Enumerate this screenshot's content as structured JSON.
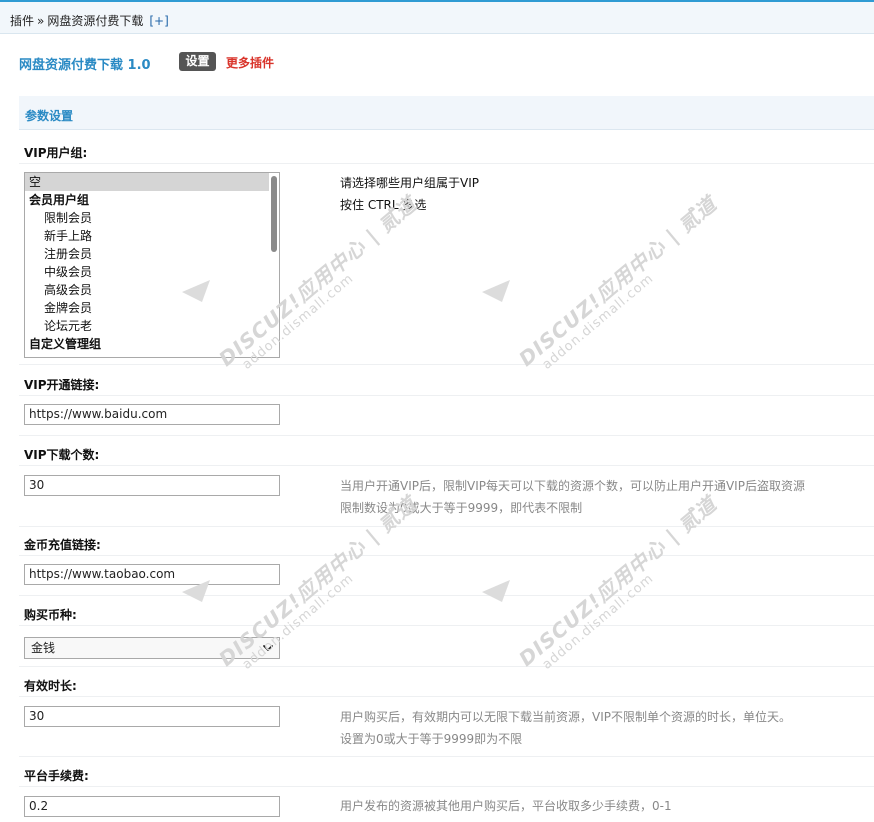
{
  "breadcrumb": {
    "root": "插件",
    "separator": "»",
    "current": "网盘资源付费下载",
    "add_label": "[+]"
  },
  "plugin": {
    "title": "网盘资源付费下载 1.0",
    "settings_label": "设置",
    "more_label": "更多插件"
  },
  "section": {
    "title": "参数设置"
  },
  "fields": {
    "vip_group": {
      "label": "VIP用户组:",
      "options": [
        {
          "text": "空",
          "kind": "item",
          "selected": true
        },
        {
          "text": "会员用户组",
          "kind": "group",
          "selected": false
        },
        {
          "text": "限制会员",
          "kind": "sub",
          "selected": false
        },
        {
          "text": "新手上路",
          "kind": "sub",
          "selected": false
        },
        {
          "text": "注册会员",
          "kind": "sub",
          "selected": false
        },
        {
          "text": "中级会员",
          "kind": "sub",
          "selected": false
        },
        {
          "text": "高级会员",
          "kind": "sub",
          "selected": false
        },
        {
          "text": "金牌会员",
          "kind": "sub",
          "selected": false
        },
        {
          "text": "论坛元老",
          "kind": "sub",
          "selected": false
        },
        {
          "text": "自定义管理组",
          "kind": "group",
          "selected": false
        }
      ],
      "hint_1": "请选择哪些用户组属于VIP",
      "hint_2": "按住 CTRL 多选"
    },
    "vip_link": {
      "label": "VIP开通链接:",
      "value": "https://www.baidu.com"
    },
    "vip_downloads": {
      "label": "VIP下载个数:",
      "value": "30",
      "hint_1": "当用户开通VIP后，限制VIP每天可以下载的资源个数，可以防止用户开通VIP后盗取资源",
      "hint_2": "限制数设为0或大于等于9999，即代表不限制"
    },
    "coin_link": {
      "label": "金币充值链接:",
      "value": "https://www.taobao.com"
    },
    "currency": {
      "label": "购买币种:",
      "selected": "金钱"
    },
    "validity": {
      "label": "有效时长:",
      "value": "30",
      "hint_1": "用户购买后，有效期内可以无限下载当前资源，VIP不限制单个资源的时长，单位天。",
      "hint_2": "设置为0或大于等于9999即为不限"
    },
    "fee": {
      "label": "平台手续费:",
      "value": "0.2",
      "hint_1": "用户发布的资源被其他用户购买后，平台收取多少手续费，0-1"
    }
  },
  "watermark": {
    "brand": "DISCUZ!应用中心",
    "domain": "addon.dismall.com",
    "tag": "贰道"
  },
  "colors": {
    "accent": "#2a8ac4",
    "more_link": "#d9342b",
    "settings_bg": "#555555"
  }
}
